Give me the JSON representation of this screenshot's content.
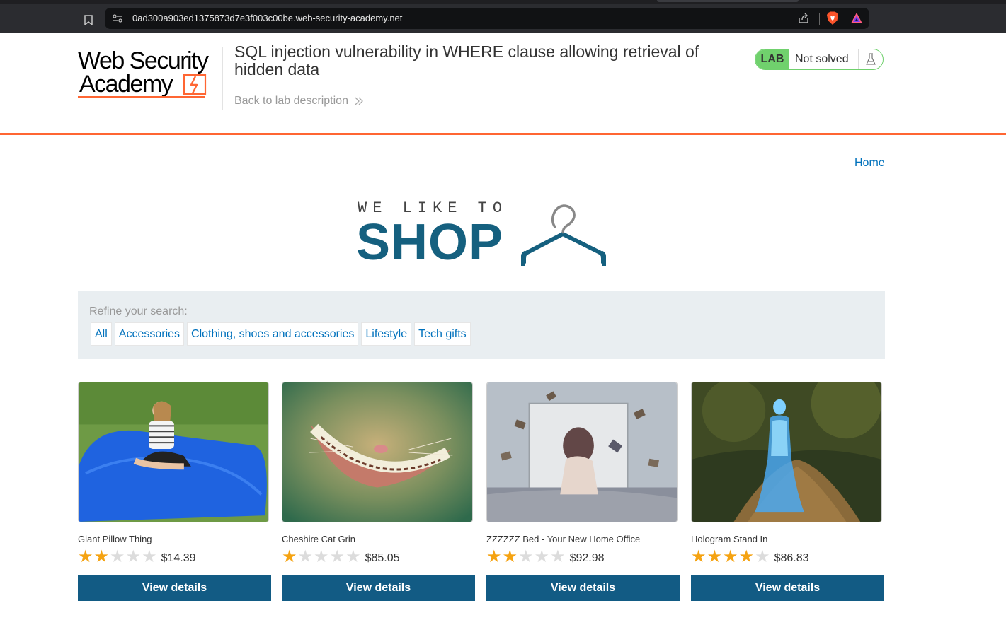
{
  "browser": {
    "url": "0ad300a903ed1375873d7e3f003c00be.web-security-academy.net",
    "bookmark_icon": "bookmark-icon",
    "site_info_icon": "site-settings-icon",
    "share_icon": "share-icon",
    "brave_icon": "brave-shields-icon",
    "rewards_icon": "brave-rewards-icon"
  },
  "academy": {
    "logo_line1": "Web Security",
    "logo_line2": "Academy",
    "lab_title": "SQL injection vulnerability in WHERE clause allowing retrieval of hidden data",
    "back_link": "Back to lab description",
    "lab_badge": "LAB",
    "lab_state": "Not solved",
    "lab_state_icon": "flask-icon",
    "accent_color": "#ff6633",
    "solved_color": "#70d16d"
  },
  "nav": {
    "home": "Home"
  },
  "banner": {
    "tagline": "WE LIKE TO",
    "shop": "SHOP",
    "hanger_icon": "hanger-icon",
    "brand_color": "#15607f"
  },
  "filters": {
    "label": "Refine your search:",
    "items": [
      "All",
      "Accessories",
      "Clothing, shoes and accessories",
      "Lifestyle",
      "Tech gifts"
    ]
  },
  "products": [
    {
      "name": "Giant Pillow Thing",
      "rating": 2,
      "rating_max": 5,
      "price": "$14.39",
      "button": "View details"
    },
    {
      "name": "Cheshire Cat Grin",
      "rating": 1,
      "rating_max": 5,
      "price": "$85.05",
      "button": "View details"
    },
    {
      "name": "ZZZZZZ Bed - Your New Home Office",
      "rating": 2,
      "rating_max": 5,
      "price": "$92.98",
      "button": "View details"
    },
    {
      "name": "Hologram Stand In",
      "rating": 4,
      "rating_max": 5,
      "price": "$86.83",
      "button": "View details"
    }
  ],
  "colors": {
    "button_bg": "#125b84",
    "link": "#0071bc",
    "star_on": "#f5a312",
    "star_off": "#dcdcdc"
  }
}
